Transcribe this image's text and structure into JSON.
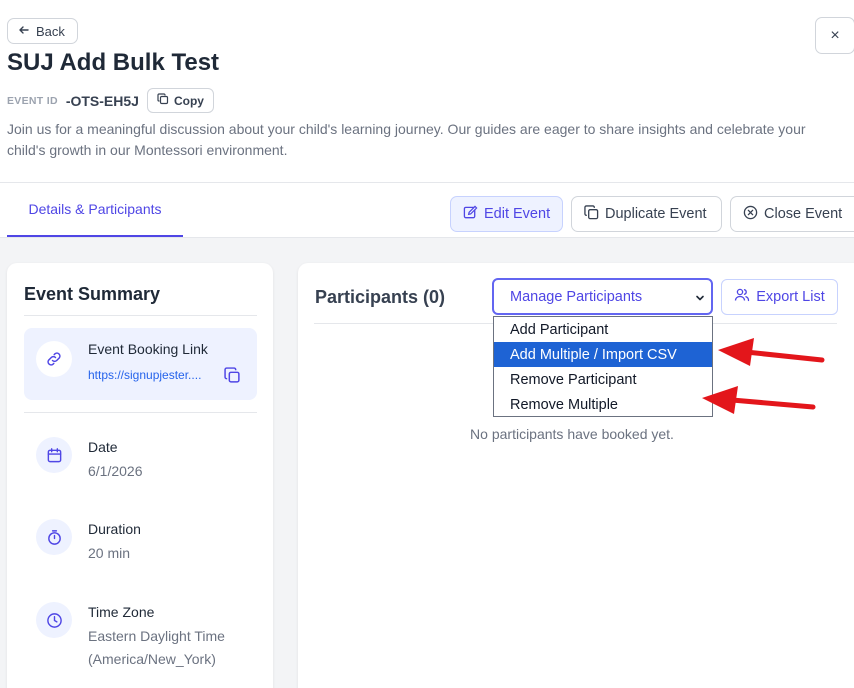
{
  "header": {
    "back_label": "Back",
    "close_label": "×",
    "title": "SUJ Add Bulk Test",
    "event_id_label": "EVENT ID",
    "event_id_value": "-OTS-EH5J",
    "copy_label": "Copy",
    "description": "Join us for a meaningful discussion about your child's learning journey. Our guides are eager to share insights and celebrate your child's growth in our Montessori environment."
  },
  "tabs": {
    "active_label": "Details & Participants"
  },
  "actions": {
    "edit_label": "Edit Event",
    "duplicate_label": "Duplicate Event",
    "close_label": "Close Event"
  },
  "summary": {
    "title": "Event Summary",
    "booking_link_label": "Event Booking Link",
    "booking_link_url": "https://signupjester....",
    "date_label": "Date",
    "date_value": "6/1/2026",
    "duration_label": "Duration",
    "duration_value": "20 min",
    "timezone_label": "Time Zone",
    "timezone_value_1": "Eastern Daylight Time",
    "timezone_value_2": "(America/New_York)"
  },
  "participants": {
    "title": "Participants (0)",
    "select_value": "Manage Participants",
    "export_label": "Export List",
    "empty_message": "No participants have booked yet.",
    "options": [
      "Add Participant",
      "Add Multiple / Import CSV",
      "Remove Participant",
      "Remove Multiple"
    ],
    "selected_option_index": 1
  },
  "colors": {
    "accent": "#4f46e5",
    "selected_option": "#1e63d4",
    "annotation_arrow": "#e3161b"
  }
}
